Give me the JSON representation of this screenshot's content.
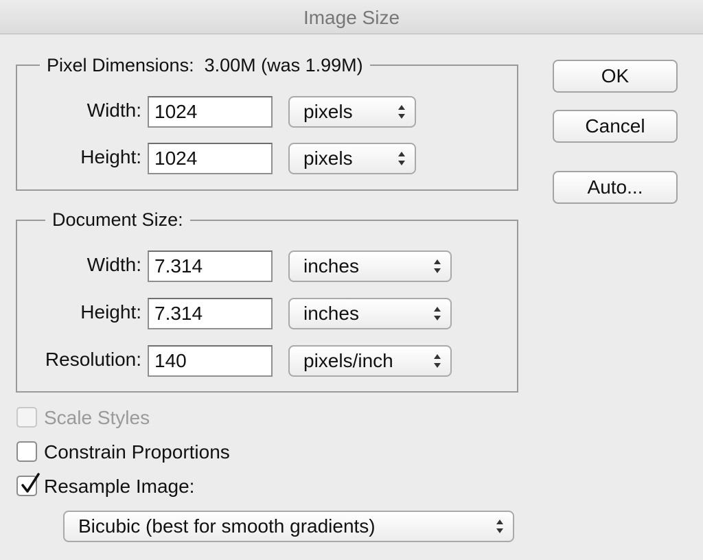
{
  "window": {
    "title": "Image Size"
  },
  "pixel_dimensions": {
    "legend": "Pixel Dimensions:  3.00M (was 1.99M)",
    "width": {
      "label": "Width:",
      "value": "1024",
      "unit": "pixels"
    },
    "height": {
      "label": "Height:",
      "value": "1024",
      "unit": "pixels"
    }
  },
  "document_size": {
    "legend": "Document Size:",
    "width": {
      "label": "Width:",
      "value": "7.314",
      "unit": "inches"
    },
    "height": {
      "label": "Height:",
      "value": "7.314",
      "unit": "inches"
    },
    "resolution": {
      "label": "Resolution:",
      "value": "140",
      "unit": "pixels/inch"
    }
  },
  "buttons": {
    "ok": "OK",
    "cancel": "Cancel",
    "auto": "Auto..."
  },
  "options": {
    "scale_styles": {
      "label": "Scale Styles",
      "checked": false,
      "enabled": false
    },
    "constrain_proportions": {
      "label": "Constrain Proportions",
      "checked": false,
      "enabled": true
    },
    "resample_image": {
      "label": "Resample Image:",
      "checked": true,
      "enabled": true
    }
  },
  "resample_method": {
    "value": "Bicubic (best for smooth gradients)"
  }
}
